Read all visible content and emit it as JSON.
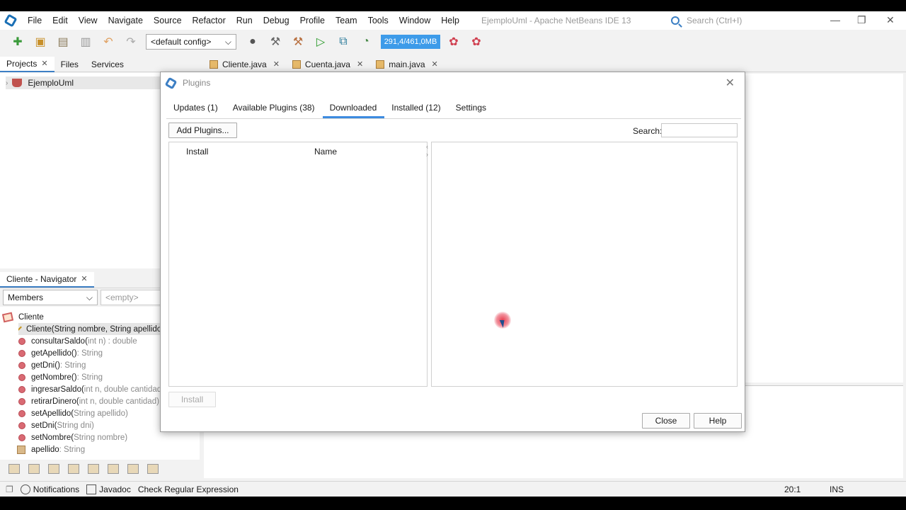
{
  "menubar": {
    "items": [
      "File",
      "Edit",
      "View",
      "Navigate",
      "Source",
      "Refactor",
      "Run",
      "Debug",
      "Profile",
      "Team",
      "Tools",
      "Window",
      "Help"
    ],
    "window_title": "EjemploUml - Apache NetBeans IDE 13",
    "search_placeholder": "Search (Ctrl+I)"
  },
  "toolbar": {
    "config": "<default config>",
    "memory": "291,4/461,0MB"
  },
  "left_tabs": [
    {
      "label": "Projects",
      "closable": true
    },
    {
      "label": "Files",
      "closable": false
    },
    {
      "label": "Services",
      "closable": false
    }
  ],
  "projects": {
    "root": "EjemploUml"
  },
  "editor_tabs": [
    {
      "label": "Cliente.java"
    },
    {
      "label": "Cuenta.java"
    },
    {
      "label": "main.java"
    }
  ],
  "navigator": {
    "title": "Cliente - Navigator",
    "filter": "Members",
    "empty": "<empty>",
    "class_name": "Cliente",
    "members": [
      {
        "name": "Cliente(String nombre, String apellido",
        "sig": "",
        "kind": "constructor",
        "selected": true
      },
      {
        "name": "consultarSaldo(",
        "sig": "int n) : double",
        "kind": "method"
      },
      {
        "name": "getApellido()",
        "sig": " : String",
        "kind": "method"
      },
      {
        "name": "getDni()",
        "sig": " : String",
        "kind": "method"
      },
      {
        "name": "getNombre()",
        "sig": " : String",
        "kind": "method"
      },
      {
        "name": "ingresarSaldo(",
        "sig": "int n, double cantidad)",
        "kind": "method"
      },
      {
        "name": "retirarDinero(",
        "sig": "int n, double cantidad)",
        "kind": "method"
      },
      {
        "name": "setApellido(",
        "sig": "String apellido)",
        "kind": "method"
      },
      {
        "name": "setDni(",
        "sig": "String dni)",
        "kind": "method"
      },
      {
        "name": "setNombre(",
        "sig": "String nombre)",
        "kind": "method"
      },
      {
        "name": "apellido",
        "sig": " : String",
        "kind": "field"
      }
    ]
  },
  "statusbar": {
    "notifications": "Notifications",
    "javadoc": "Javadoc",
    "regex": "Check Regular Expression",
    "position": "20:1",
    "mode": "INS"
  },
  "dialog": {
    "title": "Plugins",
    "tabs": [
      {
        "label": "Updates (1)"
      },
      {
        "label": "Available Plugins (38)"
      },
      {
        "label": "Downloaded",
        "active": true
      },
      {
        "label": "Installed (12)"
      },
      {
        "label": "Settings"
      }
    ],
    "add_plugins": "Add Plugins...",
    "search_label": "Search:",
    "columns": {
      "install": "Install",
      "name": "Name"
    },
    "install_button": "Install",
    "close_button": "Close",
    "help_button": "Help"
  }
}
